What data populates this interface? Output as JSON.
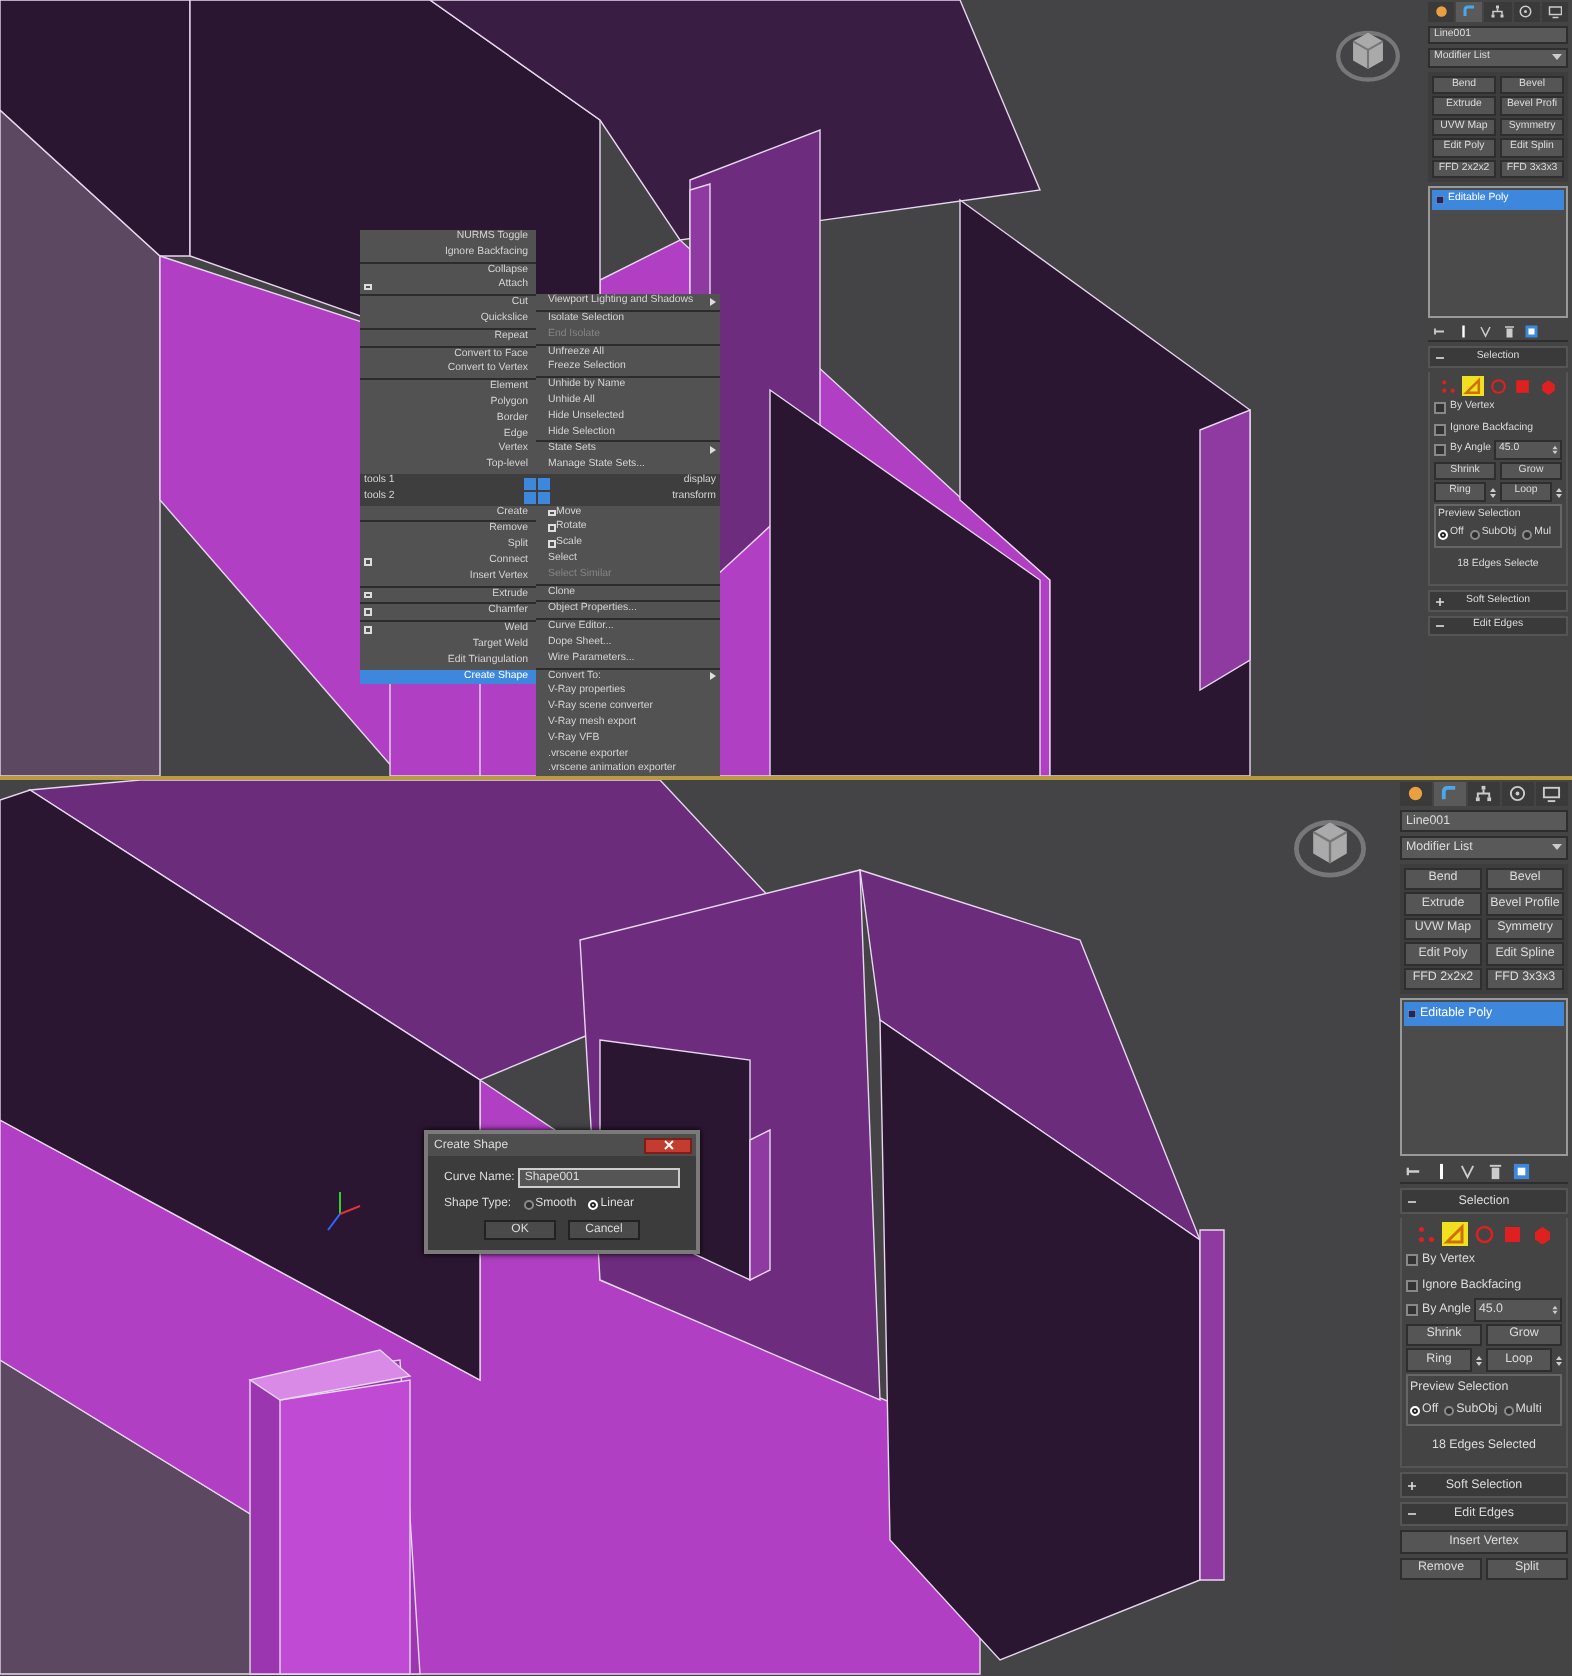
{
  "top_viewport": {
    "quad_menu": {
      "quadrants": [
        {
          "label": "tools 1",
          "groups": [
            [
              {
                "label": "NURMS Toggle",
                "kind": "plain",
                "selected": false,
                "disabled": false
              },
              {
                "label": "Ignore Backfacing",
                "kind": "plain",
                "selected": false,
                "disabled": false
              }
            ],
            [
              {
                "label": "Collapse",
                "kind": "plain",
                "selected": false,
                "disabled": false
              },
              {
                "label": "Attach",
                "kind": "options",
                "selected": false,
                "disabled": false
              }
            ],
            [
              {
                "label": "Cut",
                "kind": "plain",
                "selected": false,
                "disabled": false
              },
              {
                "label": "Quickslice",
                "kind": "plain",
                "selected": false,
                "disabled": false
              }
            ],
            [
              {
                "label": "Repeat",
                "kind": "plain",
                "selected": false,
                "disabled": false
              }
            ],
            [
              {
                "label": "Convert to Face",
                "kind": "plain",
                "selected": false,
                "disabled": false
              },
              {
                "label": "Convert to Vertex",
                "kind": "plain",
                "selected": false,
                "disabled": false
              }
            ],
            [
              {
                "label": "Element",
                "kind": "plain",
                "selected": false,
                "disabled": false
              },
              {
                "label": "Polygon",
                "kind": "plain",
                "selected": false,
                "disabled": false
              },
              {
                "label": "Border",
                "kind": "plain",
                "selected": false,
                "disabled": false
              },
              {
                "label": "Edge",
                "kind": "plain",
                "selected": false,
                "disabled": false
              },
              {
                "label": "Vertex",
                "kind": "plain",
                "selected": false,
                "disabled": false
              },
              {
                "label": "Top-level",
                "kind": "plain",
                "selected": false,
                "disabled": false
              }
            ]
          ]
        },
        {
          "label": "display",
          "groups": [
            [
              {
                "label": "Viewport Lighting and Shadows",
                "kind": "submenu",
                "selected": false,
                "disabled": false
              }
            ],
            [
              {
                "label": "Isolate Selection",
                "kind": "plain",
                "selected": false,
                "disabled": false
              },
              {
                "label": "End Isolate",
                "kind": "plain",
                "selected": false,
                "disabled": true
              }
            ],
            [
              {
                "label": "Unfreeze All",
                "kind": "plain",
                "selected": false,
                "disabled": false
              },
              {
                "label": "Freeze Selection",
                "kind": "plain",
                "selected": false,
                "disabled": false
              }
            ],
            [
              {
                "label": "Unhide by Name",
                "kind": "plain",
                "selected": false,
                "disabled": false
              },
              {
                "label": "Unhide All",
                "kind": "plain",
                "selected": false,
                "disabled": false
              },
              {
                "label": "Hide Unselected",
                "kind": "plain",
                "selected": false,
                "disabled": false
              },
              {
                "label": "Hide Selection",
                "kind": "plain",
                "selected": false,
                "disabled": false
              }
            ],
            [
              {
                "label": "State Sets",
                "kind": "submenu",
                "selected": false,
                "disabled": false
              },
              {
                "label": "Manage State Sets...",
                "kind": "plain",
                "selected": false,
                "disabled": false
              }
            ]
          ]
        },
        {
          "label": "tools 2",
          "groups": [
            [
              {
                "label": "Create",
                "kind": "plain",
                "selected": false,
                "disabled": false
              }
            ],
            [
              {
                "label": "Remove",
                "kind": "plain",
                "selected": false,
                "disabled": false
              },
              {
                "label": "Split",
                "kind": "plain",
                "selected": false,
                "disabled": false
              },
              {
                "label": "Connect",
                "kind": "options",
                "selected": false,
                "disabled": false
              },
              {
                "label": "Insert Vertex",
                "kind": "plain",
                "selected": false,
                "disabled": false
              }
            ],
            [
              {
                "label": "Extrude",
                "kind": "options",
                "selected": false,
                "disabled": false
              }
            ],
            [
              {
                "label": "Chamfer",
                "kind": "options",
                "selected": false,
                "disabled": false
              }
            ],
            [
              {
                "label": "Weld",
                "kind": "options",
                "selected": false,
                "disabled": false
              },
              {
                "label": "Target Weld",
                "kind": "plain",
                "selected": false,
                "disabled": false
              },
              {
                "label": "Edit Triangulation",
                "kind": "plain",
                "selected": false,
                "disabled": false
              },
              {
                "label": "Create Shape",
                "kind": "plain",
                "selected": true,
                "disabled": false
              }
            ]
          ]
        },
        {
          "label": "transform",
          "groups": [
            [
              {
                "label": "Move",
                "kind": "options",
                "selected": false,
                "disabled": false
              },
              {
                "label": "Rotate",
                "kind": "options",
                "selected": false,
                "disabled": false
              },
              {
                "label": "Scale",
                "kind": "options",
                "selected": false,
                "disabled": false
              },
              {
                "label": "Select",
                "kind": "plain",
                "selected": false,
                "disabled": false
              },
              {
                "label": "Select Similar",
                "kind": "plain",
                "selected": false,
                "disabled": true
              }
            ],
            [
              {
                "label": "Clone",
                "kind": "plain",
                "selected": false,
                "disabled": false
              }
            ],
            [
              {
                "label": "Object Properties...",
                "kind": "plain",
                "selected": false,
                "disabled": false
              }
            ],
            [
              {
                "label": "Curve Editor...",
                "kind": "plain",
                "selected": false,
                "disabled": false
              },
              {
                "label": "Dope Sheet...",
                "kind": "plain",
                "selected": false,
                "disabled": false
              },
              {
                "label": "Wire Parameters...",
                "kind": "plain",
                "selected": false,
                "disabled": false
              }
            ],
            [
              {
                "label": "Convert To:",
                "kind": "submenu",
                "selected": false,
                "disabled": false
              },
              {
                "label": "V-Ray properties",
                "kind": "plain",
                "selected": false,
                "disabled": false
              },
              {
                "label": "V-Ray scene converter",
                "kind": "plain",
                "selected": false,
                "disabled": false
              },
              {
                "label": "V-Ray mesh export",
                "kind": "plain",
                "selected": false,
                "disabled": false
              },
              {
                "label": "V-Ray VFB",
                "kind": "plain",
                "selected": false,
                "disabled": false
              },
              {
                "label": ".vrscene exporter",
                "kind": "plain",
                "selected": false,
                "disabled": false
              },
              {
                "label": ".vrscene animation exporter",
                "kind": "plain",
                "selected": false,
                "disabled": false
              }
            ]
          ]
        }
      ]
    },
    "command_panel": {
      "tabs": [
        {
          "kind": "create",
          "selected": false
        },
        {
          "kind": "modify",
          "selected": true
        },
        {
          "kind": "hierarchy",
          "selected": false
        },
        {
          "kind": "motion",
          "selected": false
        },
        {
          "kind": "display",
          "selected": false
        }
      ],
      "object_name": "Line001",
      "modifier_list": "Modifier List",
      "modifier_buttons": [
        "Bend",
        "Bevel",
        "Extrude",
        "Bevel Profi",
        "UVW Map",
        "Symmetry",
        "Edit Poly",
        "Edit Splin",
        "FFD 2x2x2",
        "FFD 3x3x3"
      ],
      "stack": [
        {
          "label": "Editable Poly",
          "selected": true
        }
      ],
      "selection": {
        "title": "Selection",
        "expanded": true,
        "levels": [
          {
            "kind": "vertex",
            "selected": false
          },
          {
            "kind": "edge",
            "selected": true
          },
          {
            "kind": "border",
            "selected": false
          },
          {
            "kind": "polygon",
            "selected": false
          },
          {
            "kind": "element",
            "selected": false
          }
        ],
        "checks": [
          {
            "label": "By Vertex",
            "checked": false
          },
          {
            "label": "Ignore Backfacing",
            "checked": false
          },
          {
            "label": "By Angle",
            "checked": false
          }
        ],
        "angle": "45.0",
        "shrink": "Shrink",
        "grow": "Grow",
        "ring": "Ring",
        "loop": "Loop",
        "preview_title": "Preview Selection",
        "preview_options": [
          {
            "label": "Off",
            "selected": true
          },
          {
            "label": "SubObj",
            "selected": false
          },
          {
            "label": "Mul",
            "selected": false
          }
        ],
        "status": "18 Edges Selecte"
      },
      "rollouts": [
        {
          "label": "Soft Selection",
          "expanded": false
        },
        {
          "label": "Edit Edges",
          "expanded": true
        }
      ]
    }
  },
  "bottom_viewport": {
    "dialog": {
      "title": "Create Shape",
      "name_label": "Curve Name:",
      "name_value": "Shape001",
      "type_label": "Shape Type:",
      "types": [
        {
          "label": "Smooth",
          "selected": false
        },
        {
          "label": "Linear",
          "selected": true
        }
      ],
      "buttons": [
        "OK",
        "Cancel"
      ]
    },
    "command_panel": {
      "tabs": [
        {
          "kind": "create",
          "selected": false
        },
        {
          "kind": "modify",
          "selected": true
        },
        {
          "kind": "hierarchy",
          "selected": false
        },
        {
          "kind": "motion",
          "selected": false
        },
        {
          "kind": "display",
          "selected": false
        }
      ],
      "object_name": "Line001",
      "modifier_list": "Modifier List",
      "modifier_buttons": [
        "Bend",
        "Bevel",
        "Extrude",
        "Bevel Profile",
        "UVW Map",
        "Symmetry",
        "Edit Poly",
        "Edit Spline",
        "FFD 2x2x2",
        "FFD 3x3x3"
      ],
      "stack": [
        {
          "label": "Editable Poly",
          "selected": true
        }
      ],
      "selection": {
        "title": "Selection",
        "expanded": true,
        "levels": [
          {
            "kind": "vertex",
            "selected": false
          },
          {
            "kind": "edge",
            "selected": true
          },
          {
            "kind": "border",
            "selected": false
          },
          {
            "kind": "polygon",
            "selected": false
          },
          {
            "kind": "element",
            "selected": false
          }
        ],
        "checks": [
          {
            "label": "By Vertex",
            "checked": false
          },
          {
            "label": "Ignore Backfacing",
            "checked": false
          },
          {
            "label": "By Angle",
            "checked": false
          }
        ],
        "angle": "45.0",
        "shrink": "Shrink",
        "grow": "Grow",
        "ring": "Ring",
        "loop": "Loop",
        "preview_title": "Preview Selection",
        "preview_options": [
          {
            "label": "Off",
            "selected": true
          },
          {
            "label": "SubObj",
            "selected": false
          },
          {
            "label": "Multi",
            "selected": false
          }
        ],
        "status": "18 Edges Selected"
      },
      "rollouts": [
        {
          "label": "Soft Selection",
          "expanded": false
        },
        {
          "label": "Edit Edges",
          "expanded": true
        }
      ],
      "edit_edges_buttons": [
        "Insert Vertex",
        "Remove",
        "Split"
      ]
    }
  }
}
